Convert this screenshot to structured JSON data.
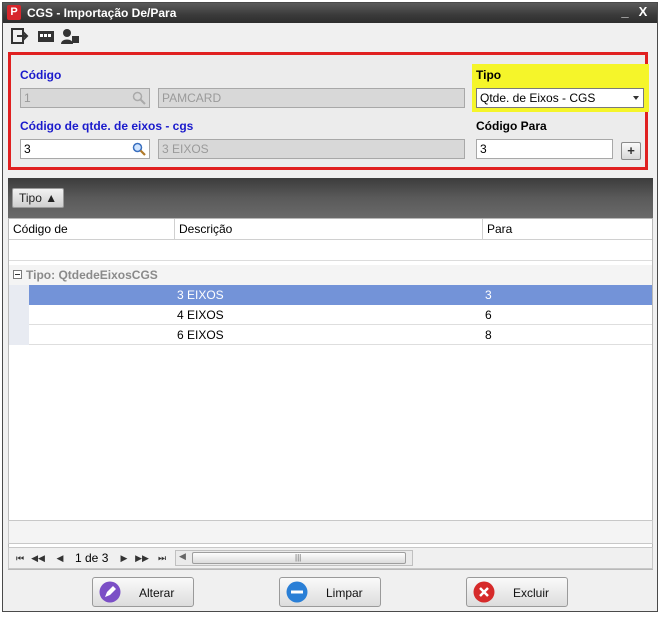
{
  "window": {
    "title": "CGS - Importação De/Para",
    "logo_letter": "P",
    "minimize": "_",
    "close": "X"
  },
  "toolbar": {
    "icons": [
      "exit-icon",
      "card-icon",
      "user-icon"
    ]
  },
  "form": {
    "codigo_label": "Código",
    "codigo_value": "1",
    "codigo_desc": "PAMCARD",
    "tipo_label": "Tipo",
    "tipo_selected": "Qtde. de Eixos - CGS",
    "eixos_label": "Código de qtde. de eixos - cgs",
    "eixos_value": "3",
    "eixos_desc": "3 EIXOS",
    "codigo_para_label": "Código Para",
    "codigo_para_value": "3",
    "add_label": "+"
  },
  "colors": {
    "highlight_border": "#e02020",
    "tipo_highlight": "#f5f52a",
    "label_blue": "#1a1acc",
    "selected_row": "#7393d8"
  },
  "group_panel": {
    "chip_label": "Tipo ▲"
  },
  "grid": {
    "columns": [
      "Código de",
      "Descrição",
      "Para"
    ],
    "group_label": "Tipo: QtdedeEixosCGS",
    "rows": [
      {
        "codigo": "",
        "descricao": "3 EIXOS",
        "para": "3",
        "selected": true
      },
      {
        "codigo": "",
        "descricao": "4 EIXOS",
        "para": "6",
        "selected": false
      },
      {
        "codigo": "",
        "descricao": "6 EIXOS",
        "para": "8",
        "selected": false
      }
    ]
  },
  "pager": {
    "page_text": "1 de 3"
  },
  "buttons": {
    "alterar": "Alterar",
    "limpar": "Limpar",
    "excluir": "Excluir"
  }
}
